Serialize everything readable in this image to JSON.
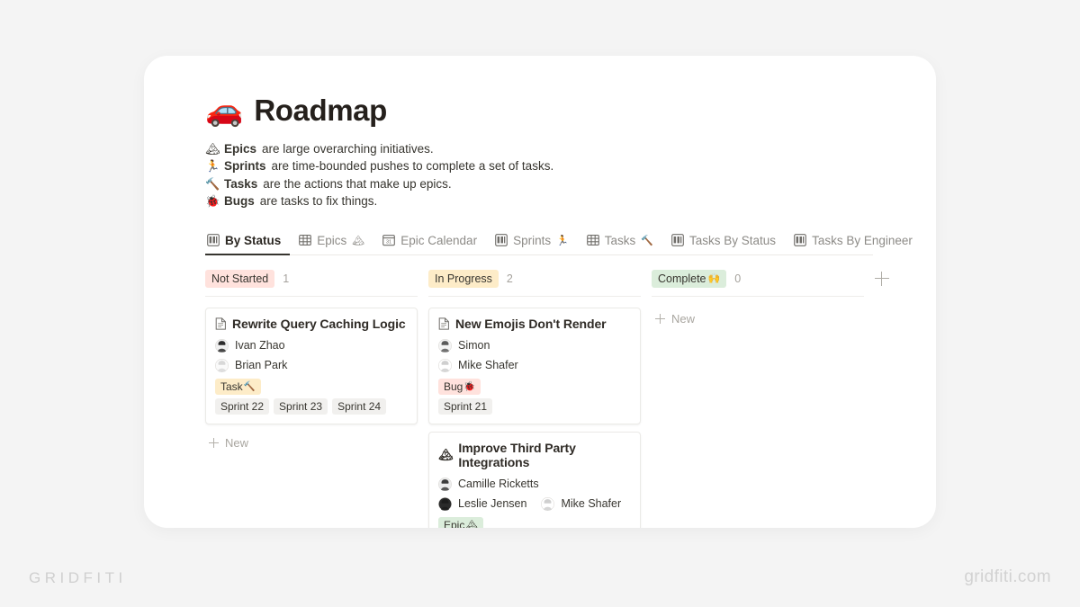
{
  "page": {
    "title": "Roadmap",
    "title_emoji": "🚗",
    "background_color": "#f4f4f4",
    "panel_color": "#ffffff"
  },
  "legend": [
    {
      "emoji": "🏔",
      "term": "Epics",
      "text": "are large overarching initiatives."
    },
    {
      "emoji": "🏃",
      "term": "Sprints",
      "text": "are time-bounded pushes to complete a set of tasks."
    },
    {
      "emoji": "🔨",
      "term": "Tasks",
      "text": "are the actions that make up epics."
    },
    {
      "emoji": "🐞",
      "term": "Bugs",
      "text": "are tasks to fix things."
    }
  ],
  "tabs": [
    {
      "label": "By Status",
      "icon": "board-icon",
      "emoji": "",
      "active": true
    },
    {
      "label": "Epics",
      "icon": "table-icon",
      "emoji": "🏔",
      "active": false
    },
    {
      "label": "Epic Calendar",
      "icon": "calendar-icon",
      "emoji": "",
      "active": false
    },
    {
      "label": "Sprints",
      "icon": "board-icon",
      "emoji": "🏃",
      "active": false
    },
    {
      "label": "Tasks",
      "icon": "table-icon",
      "emoji": "🔨",
      "active": false
    },
    {
      "label": "Tasks By Status",
      "icon": "board-icon",
      "emoji": "",
      "active": false
    },
    {
      "label": "Tasks By Engineer",
      "icon": "board-icon",
      "emoji": "",
      "active": false
    }
  ],
  "board": {
    "add_column_label": "+",
    "new_label": "New",
    "columns": [
      {
        "name": "Not Started",
        "emoji": "",
        "count": "1",
        "chip_bg": "#ffe2dd",
        "cards": [
          {
            "title": "Rewrite Query Caching Logic",
            "icon": "document-icon",
            "people": [
              {
                "name": "Ivan Zhao",
                "avatar_hair": "#2c2c2c",
                "avatar_skin": "#f0f0f0"
              },
              {
                "name": "Brian Park",
                "avatar_hair": "#d8d8d8",
                "avatar_skin": "#fafafa"
              }
            ],
            "tags": [
              {
                "label": "Task",
                "emoji": "🔨",
                "bg": "#fdecc8"
              }
            ],
            "sprints": [
              {
                "label": "Sprint 22",
                "bg": "#f1f0ee"
              },
              {
                "label": "Sprint 23",
                "bg": "#f1f0ee"
              },
              {
                "label": "Sprint 24",
                "bg": "#f1f0ee"
              }
            ]
          }
        ]
      },
      {
        "name": "In Progress",
        "emoji": "",
        "count": "2",
        "chip_bg": "#fdecc8",
        "cards": [
          {
            "title": "New Emojis Don't Render",
            "icon": "document-icon",
            "people": [
              {
                "name": "Simon",
                "avatar_hair": "#5a5a5a",
                "avatar_skin": "#f4f4f4"
              },
              {
                "name": "Mike Shafer",
                "avatar_hair": "#cfcfcf",
                "avatar_skin": "#ffffff"
              }
            ],
            "tags": [
              {
                "label": "Bug",
                "emoji": "🐞",
                "bg": "#ffe2dd"
              }
            ],
            "sprints": [
              {
                "label": "Sprint 21",
                "bg": "#f1f0ee"
              }
            ]
          },
          {
            "title": "Improve Third Party Integrations",
            "icon": "mountain-icon",
            "people": [
              {
                "name": "Camille Ricketts",
                "avatar_hair": "#3d3d3d",
                "avatar_skin": "#ededed"
              },
              {
                "name": "Leslie Jensen",
                "avatar_hair": "#1c1c1c",
                "avatar_skin": "#2a2a2a"
              },
              {
                "name": "Mike Shafer",
                "avatar_hair": "#cfcfcf",
                "avatar_skin": "#ffffff"
              }
            ],
            "tags": [
              {
                "label": "Epic",
                "emoji": "🏔",
                "bg": "#dbeddb"
              }
            ],
            "sprints": []
          }
        ]
      },
      {
        "name": "Complete",
        "emoji": "🙌",
        "count": "0",
        "chip_bg": "#dbeddb",
        "cards": []
      }
    ]
  },
  "watermarks": {
    "left": "GRIDFITI",
    "right": "gridfiti.com"
  }
}
